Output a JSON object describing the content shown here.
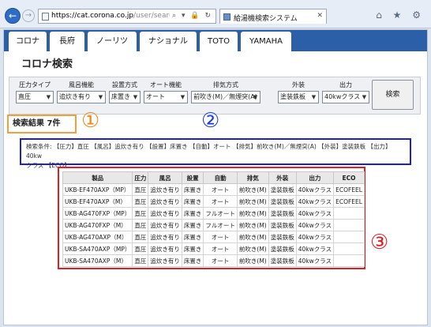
{
  "browser": {
    "url_host": "https://cat.corona.co.jp",
    "url_path": "/user/search/corona",
    "tab_title": "給湯機検索システム",
    "address_tools": "⌕ ▾ 🔒 ↻",
    "chrome_icons": "⌂ ★ ⚙"
  },
  "tabs": [
    {
      "label": "コロナ"
    },
    {
      "label": "長府"
    },
    {
      "label": "ノーリツ"
    },
    {
      "label": "ナショナル"
    },
    {
      "label": "TOTO"
    },
    {
      "label": "YAMAHA"
    }
  ],
  "page_title": "コロナ検索",
  "filters": [
    {
      "label": "圧力タイプ",
      "value": "直圧"
    },
    {
      "label": "風呂機能",
      "value": "追炊き有り"
    },
    {
      "label": "設置方式",
      "value": "床置き"
    },
    {
      "label": "オート機能",
      "value": "オート"
    },
    {
      "label": "排気方式",
      "value": "前吹き(M)／無煙突(A)"
    },
    {
      "label": "外装",
      "value": "塗装鉄板"
    },
    {
      "label": "出力",
      "value": "40kwクラス"
    }
  ],
  "search_button": "検索",
  "results": {
    "label": "検索結果 7件",
    "conditions_line1": "検索条件: 【圧力】直圧 【風呂】追炊き有り 【設置】床置き 【自動】オート 【排気】前吹き(M)／無煙突(A) 【外装】塗装鉄板 【出力】40kw",
    "conditions_line2": "クラス 【ECO】",
    "columns": [
      "製品",
      "圧力",
      "風呂",
      "設置",
      "自動",
      "排気",
      "外装",
      "出力",
      "ECO"
    ],
    "rows": [
      [
        "UKB-EF470AXP（MP）",
        "直圧",
        "追炊き有り",
        "床置き",
        "オート",
        "前吹き(M)",
        "塗装鉄板",
        "40kwクラス",
        "ECOFEEL"
      ],
      [
        "UKB-EF470AXP（M）",
        "直圧",
        "追炊き有り",
        "床置き",
        "オート",
        "前吹き(M)",
        "塗装鉄板",
        "40kwクラス",
        "ECOFEEL"
      ],
      [
        "UKB-AG470FXP（MP）",
        "直圧",
        "追炊き有り",
        "床置き",
        "フルオート",
        "前吹き(M)",
        "塗装鉄板",
        "40kwクラス",
        ""
      ],
      [
        "UKB-AG470FXP（M）",
        "直圧",
        "追炊き有り",
        "床置き",
        "フルオート",
        "前吹き(M)",
        "塗装鉄板",
        "40kwクラス",
        ""
      ],
      [
        "UKB-AG470AXP（M）",
        "直圧",
        "追炊き有り",
        "床置き",
        "オート",
        "前吹き(M)",
        "塗装鉄板",
        "40kwクラス",
        ""
      ],
      [
        "UKB-SA470AXP（MP）",
        "直圧",
        "追炊き有り",
        "床置き",
        "オート",
        "前吹き(M)",
        "塗装鉄板",
        "40kwクラス",
        ""
      ],
      [
        "UKB-SA470AXP（M）",
        "直圧",
        "追炊き有り",
        "床置き",
        "オート",
        "前吹き(M)",
        "塗装鉄板",
        "40kwクラス",
        ""
      ]
    ]
  },
  "markers": [
    {
      "label": "①",
      "color": "#f08a1a"
    },
    {
      "label": "②",
      "color": "#1a3fd8"
    },
    {
      "label": "③",
      "color": "#e01a1a"
    }
  ]
}
